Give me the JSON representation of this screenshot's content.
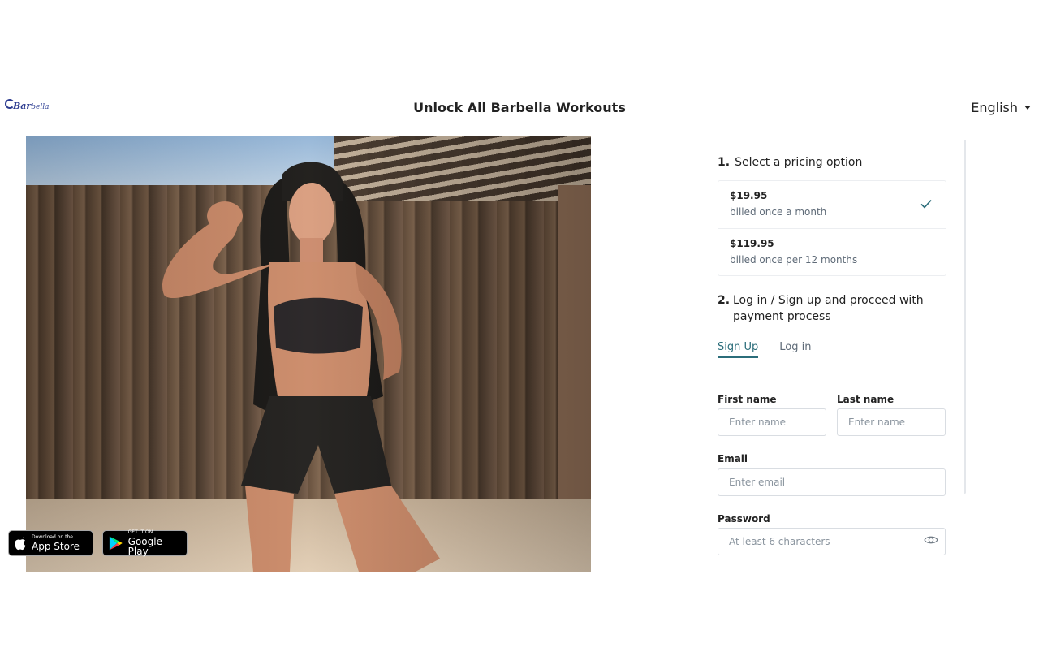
{
  "header": {
    "logo_text_bold": "Bar",
    "logo_text_thin": "bella",
    "title": "Unlock All Barbella Workouts",
    "language": "English"
  },
  "hero": {
    "image_alt": "Woman flexing bicep in front of wooden fence"
  },
  "badges": {
    "apple_small": "Download on the",
    "apple_big": "App Store",
    "google_small": "GET IT ON",
    "google_big": "Google Play"
  },
  "steps": {
    "step1_num": "1.",
    "step1_label": "Select a pricing option",
    "step2_num": "2.",
    "step2_label": "Log in / Sign up and proceed with payment process"
  },
  "pricing": [
    {
      "price": "$19.95",
      "desc": "billed once a month",
      "selected": true
    },
    {
      "price": "$119.95",
      "desc": "billed once per 12 months",
      "selected": false
    }
  ],
  "tabs": {
    "signup": "Sign Up",
    "login": "Log in"
  },
  "form": {
    "first_name_label": "First name",
    "first_name_placeholder": "Enter name",
    "last_name_label": "Last name",
    "last_name_placeholder": "Enter name",
    "email_label": "Email",
    "email_placeholder": "Enter email",
    "password_label": "Password",
    "password_placeholder": "At least 6 characters"
  },
  "colors": {
    "accent": "#2b6d7a",
    "logo": "#2b3a8f"
  }
}
